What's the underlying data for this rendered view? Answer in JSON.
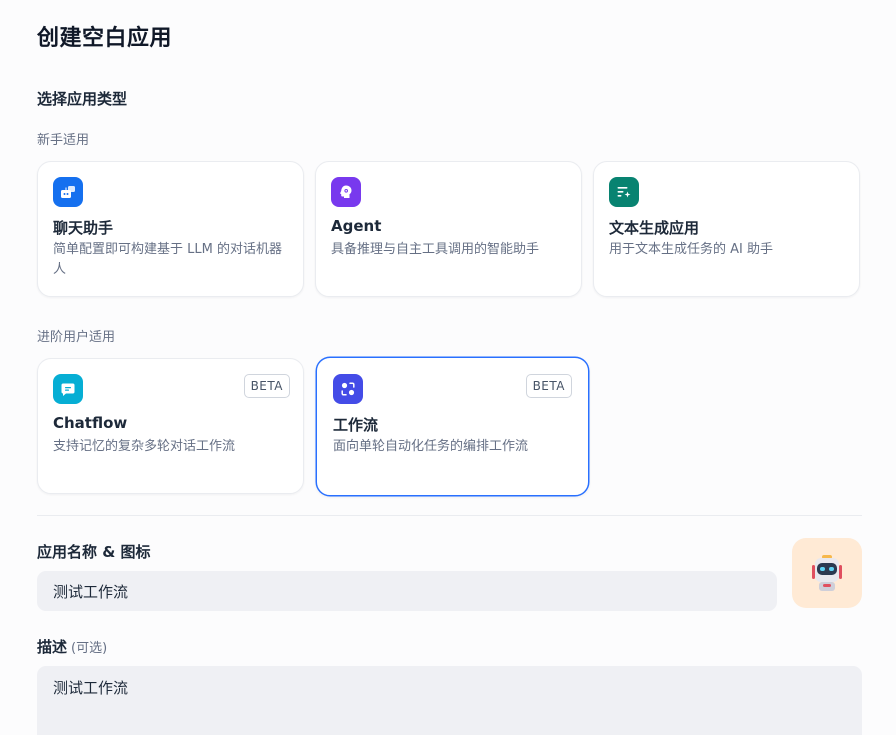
{
  "page_title": "创建空白应用",
  "app_type_section": {
    "title": "选择应用类型",
    "beginner_label": "新手适用",
    "advanced_label": "进阶用户适用"
  },
  "app_types": {
    "chatbot": {
      "name": "聊天助手",
      "description": "简单配置即可构建基于 LLM 的对话机器人",
      "icon": "chat-bot-icon",
      "color": "#1570ef"
    },
    "agent": {
      "name": "Agent",
      "description": "具备推理与自主工具调用的智能助手",
      "icon": "agent-icon",
      "color": "#7839ee"
    },
    "text_generation": {
      "name": "文本生成应用",
      "description": "用于文本生成任务的 AI 助手",
      "icon": "text-generation-icon",
      "color": "#088371"
    },
    "chatflow": {
      "name": "Chatflow",
      "description": "支持记忆的复杂多轮对话工作流",
      "badge": "BETA",
      "icon": "chatflow-icon",
      "color": "#06aed4"
    },
    "workflow": {
      "name": "工作流",
      "description": "面向单轮自动化任务的编排工作流",
      "badge": "BETA",
      "icon": "workflow-icon",
      "color": "#444ce7"
    }
  },
  "selected_type": "workflow",
  "name_field": {
    "label": "应用名称 & 图标",
    "value": "测试工作流"
  },
  "app_icon": {
    "icon": "robot-icon",
    "background": "#ffead5"
  },
  "description_field": {
    "label": "描述",
    "optional_label": "(可选)",
    "value": "测试工作流"
  },
  "colors": {
    "accent": "#2970ff"
  }
}
